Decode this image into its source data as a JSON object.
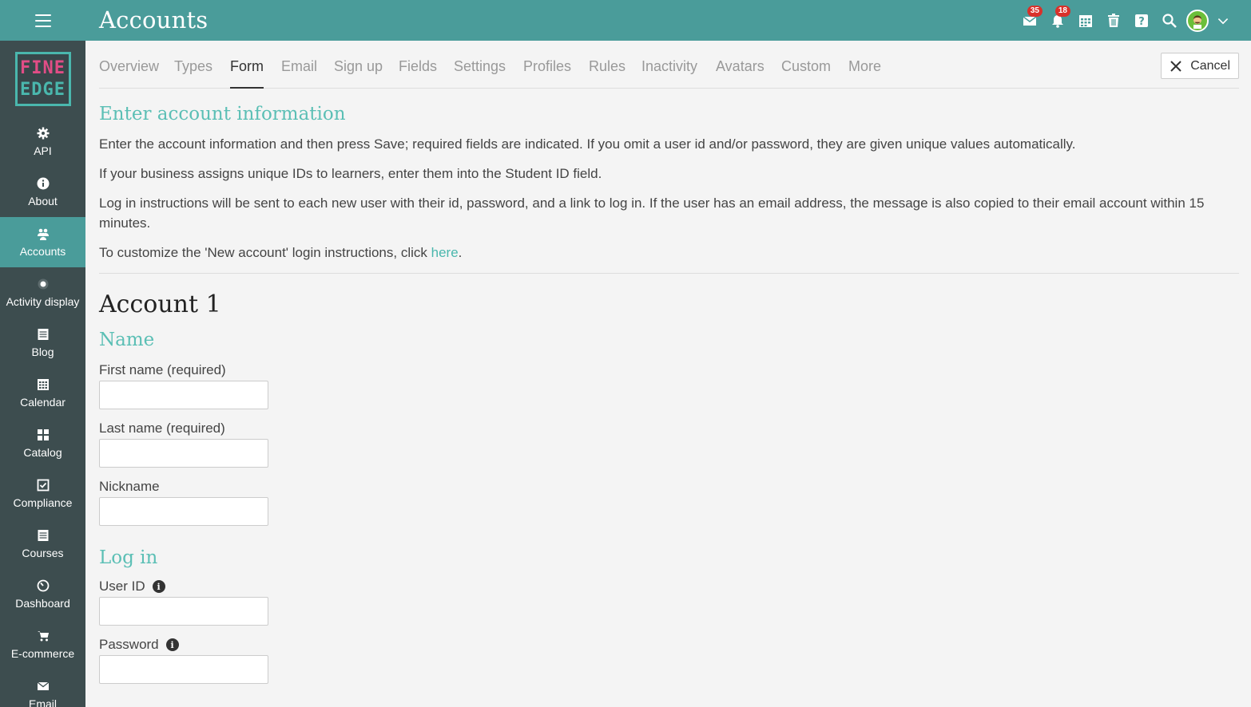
{
  "header": {
    "title": "Accounts",
    "mail_badge": "35",
    "notifications_badge": "18"
  },
  "sidebar": {
    "logo_line1": "FINE",
    "logo_line2": "EDGE",
    "items": [
      {
        "label": "API",
        "icon": "gear-icon"
      },
      {
        "label": "About",
        "icon": "info-icon"
      },
      {
        "label": "Accounts",
        "icon": "users-icon",
        "active": true
      },
      {
        "label": "Activity display",
        "icon": "dot-icon"
      },
      {
        "label": "Blog",
        "icon": "blog-icon"
      },
      {
        "label": "Calendar",
        "icon": "calendar-icon"
      },
      {
        "label": "Catalog",
        "icon": "grid-icon"
      },
      {
        "label": "Compliance",
        "icon": "checkbox-icon"
      },
      {
        "label": "Courses",
        "icon": "courses-icon"
      },
      {
        "label": "Dashboard",
        "icon": "gauge-icon"
      },
      {
        "label": "E-commerce",
        "icon": "cart-icon"
      },
      {
        "label": "Email",
        "icon": "envelope-icon"
      }
    ]
  },
  "tabs": [
    "Overview",
    "Types",
    "Form",
    "Email",
    "Sign up",
    "Fields",
    "Settings",
    "Profiles",
    "Rules",
    "Inactivity",
    "Avatars",
    "Custom",
    "More"
  ],
  "active_tab": "Form",
  "cancel_label": "Cancel",
  "intro": {
    "heading": "Enter account information",
    "p1": "Enter the account information and then press Save; required fields are indicated. If you omit a user id and/or password, they are given unique values automatically.",
    "p2": "If your business assigns unique IDs to learners, enter them into the Student ID field.",
    "p3": "Log in instructions will be sent to each new user with their id, password, and a link to log in. If the user has an email address, the message is also copied to their email account within 15 minutes.",
    "p4_prefix": "To customize the 'New account' login instructions, click ",
    "p4_link": "here",
    "p4_suffix": "."
  },
  "account": {
    "heading": "Account 1",
    "name_heading": "Name",
    "first_name_label": "First name (required)",
    "last_name_label": "Last name (required)",
    "nickname_label": "Nickname",
    "login_heading": "Log in",
    "user_id_label": "User ID",
    "password_label": "Password"
  },
  "colors": {
    "topbar": "#4a9c9a",
    "sidebar": "#3d4d4f",
    "accent": "#5bbfb5",
    "badge": "#d9312b"
  }
}
